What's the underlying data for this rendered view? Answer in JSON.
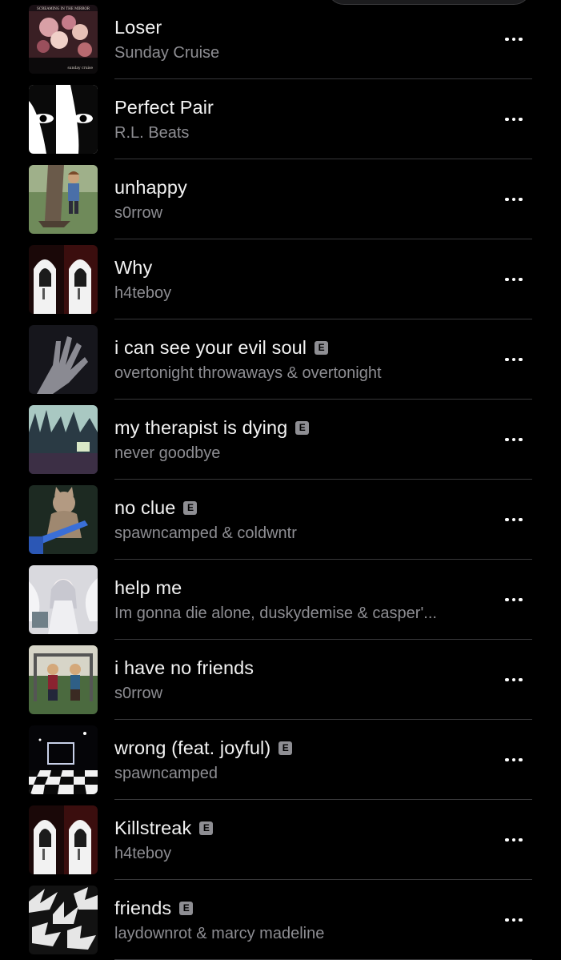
{
  "explicit_badge_label": "E",
  "more_button_icon": "ellipsis-icon",
  "tracks": [
    {
      "title": "Loser",
      "artist": "Sunday Cruise",
      "explicit": false,
      "cover_text_top": "SCREAMING IN THE MIRROR",
      "cover_text_bottom": "sunday cruise",
      "artwork": "cover-pink-collage"
    },
    {
      "title": "Perfect Pair",
      "artist": "R.L. Beats",
      "explicit": false,
      "artwork": "cover-bw-eyes"
    },
    {
      "title": "unhappy",
      "artist": "s0rrow",
      "explicit": false,
      "artwork": "cover-tree-boy"
    },
    {
      "title": "Why",
      "artist": "h4teboy",
      "explicit": false,
      "artwork": "cover-hooded-figures"
    },
    {
      "title": "i can see your evil soul",
      "artist": "overtonight throwaways & overtonight",
      "explicit": true,
      "artwork": "cover-dark-hand"
    },
    {
      "title": "my therapist is dying",
      "artist": "never goodbye",
      "explicit": true,
      "artwork": "cover-blurred-forest"
    },
    {
      "title": "no clue",
      "artist": "spawncamped & coldwntr",
      "explicit": true,
      "artwork": "cover-cat-guitar"
    },
    {
      "title": "help me",
      "artist": "Im gonna die alone, duskydemise & casper'...",
      "explicit": false,
      "artwork": "cover-anime-sketch"
    },
    {
      "title": "i have no friends",
      "artist": "s0rrow",
      "explicit": false,
      "artwork": "cover-swing-boys"
    },
    {
      "title": "wrong (feat. joyful)",
      "artist": "spawncamped",
      "explicit": true,
      "artwork": "cover-checker-void"
    },
    {
      "title": "Killstreak",
      "artist": "h4teboy",
      "explicit": true,
      "artwork": "cover-hooded-figures"
    },
    {
      "title": "friends",
      "artist": "laydownrot & marcy madeline",
      "explicit": true,
      "artwork": "cover-spiky-smiles"
    }
  ]
}
